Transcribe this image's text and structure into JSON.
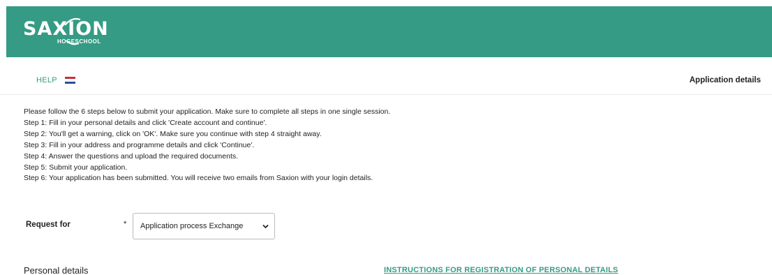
{
  "header": {
    "logo_text": "SAXION",
    "logo_subtext": "HOGESCHOOL",
    "background_color": "#359b84"
  },
  "topbar": {
    "help_label": "HELP",
    "language_flag_icon": "netherlands-flag-icon",
    "page_title": "Application details"
  },
  "instructions": [
    "Please follow the 6 steps below to submit your application. Make sure to complete all steps in one single session.",
    "Step 1: Fill in your personal details and click 'Create account and continue'.",
    "Step 2: You'll get a warning, click on 'OK'. Make sure you continue with step 4 straight away.",
    "Step 3: Fill in your address and programme details and click 'Continue'.",
    "Step 4: Answer the questions and upload the required documents.",
    "Step 5: Submit your application.",
    "Step 6: Your application has been submitted. You will receive two emails from Saxion with your login details."
  ],
  "request": {
    "label": "Request for",
    "required_marker": "*",
    "selected_value": "Application process Exchange"
  },
  "personal_details": {
    "heading": "Personal details",
    "instructions_link": "INSTRUCTIONS FOR REGISTRATION OF PERSONAL DETAILS"
  },
  "colors": {
    "accent": "#359b84",
    "text": "#222222"
  }
}
